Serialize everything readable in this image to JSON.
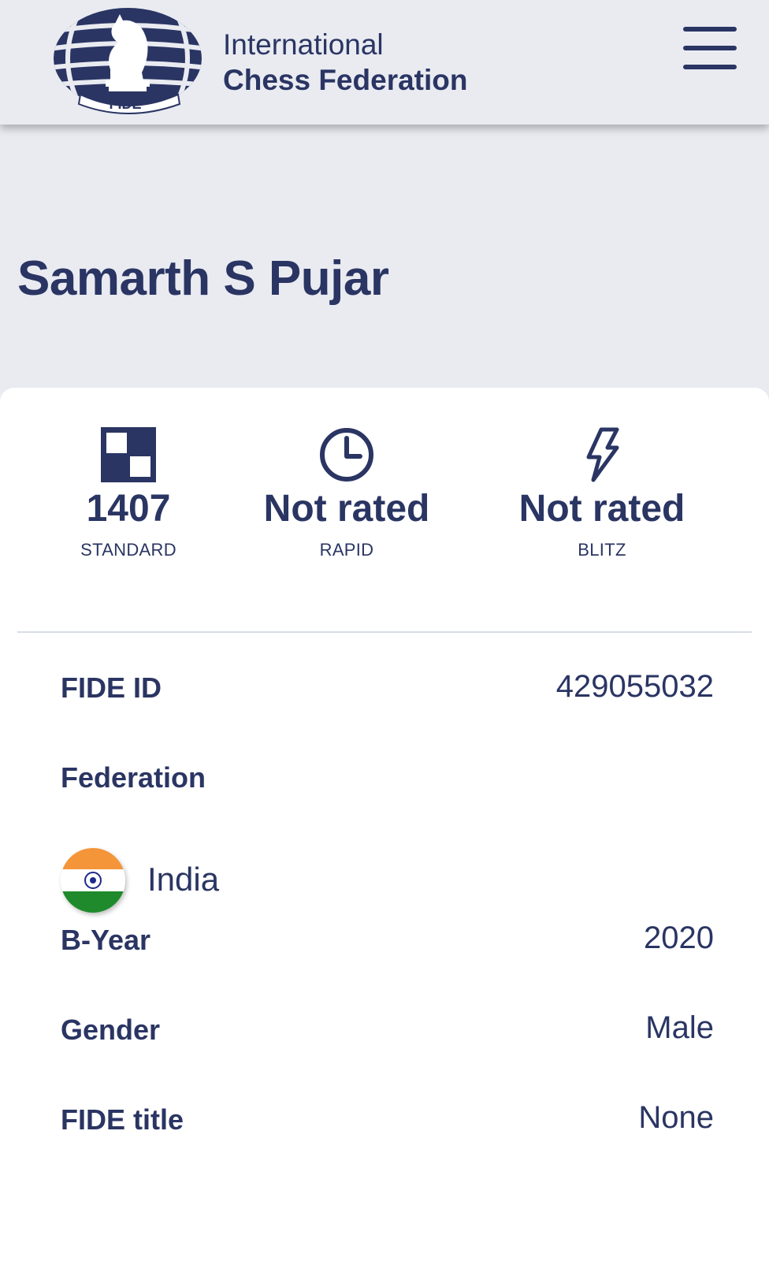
{
  "header": {
    "logo_text": "FIDE",
    "brand_line1": "International",
    "brand_line2": "Chess Federation",
    "menu_icon": "hamburger-menu-icon"
  },
  "player": {
    "name": "Samarth S Pujar"
  },
  "ratings": [
    {
      "value": "1407",
      "label": "STANDARD",
      "icon": "chessboard-icon"
    },
    {
      "value": "Not rated",
      "label": "RAPID",
      "icon": "clock-icon"
    },
    {
      "value": "Not rated",
      "label": "BLITZ",
      "icon": "lightning-icon"
    }
  ],
  "details": {
    "fide_id_label": "FIDE ID",
    "fide_id_value": "429055032",
    "federation_label": "Federation",
    "federation_country": "India",
    "byear_label": "B-Year",
    "byear_value": "2020",
    "gender_label": "Gender",
    "gender_value": "Male",
    "title_label": "FIDE title",
    "title_value": "None"
  },
  "colors": {
    "navy": "#2a3563",
    "background": "#e9ebf1",
    "card": "#ffffff",
    "flag_saffron": "#f4953a",
    "flag_green": "#1f8a2c"
  }
}
